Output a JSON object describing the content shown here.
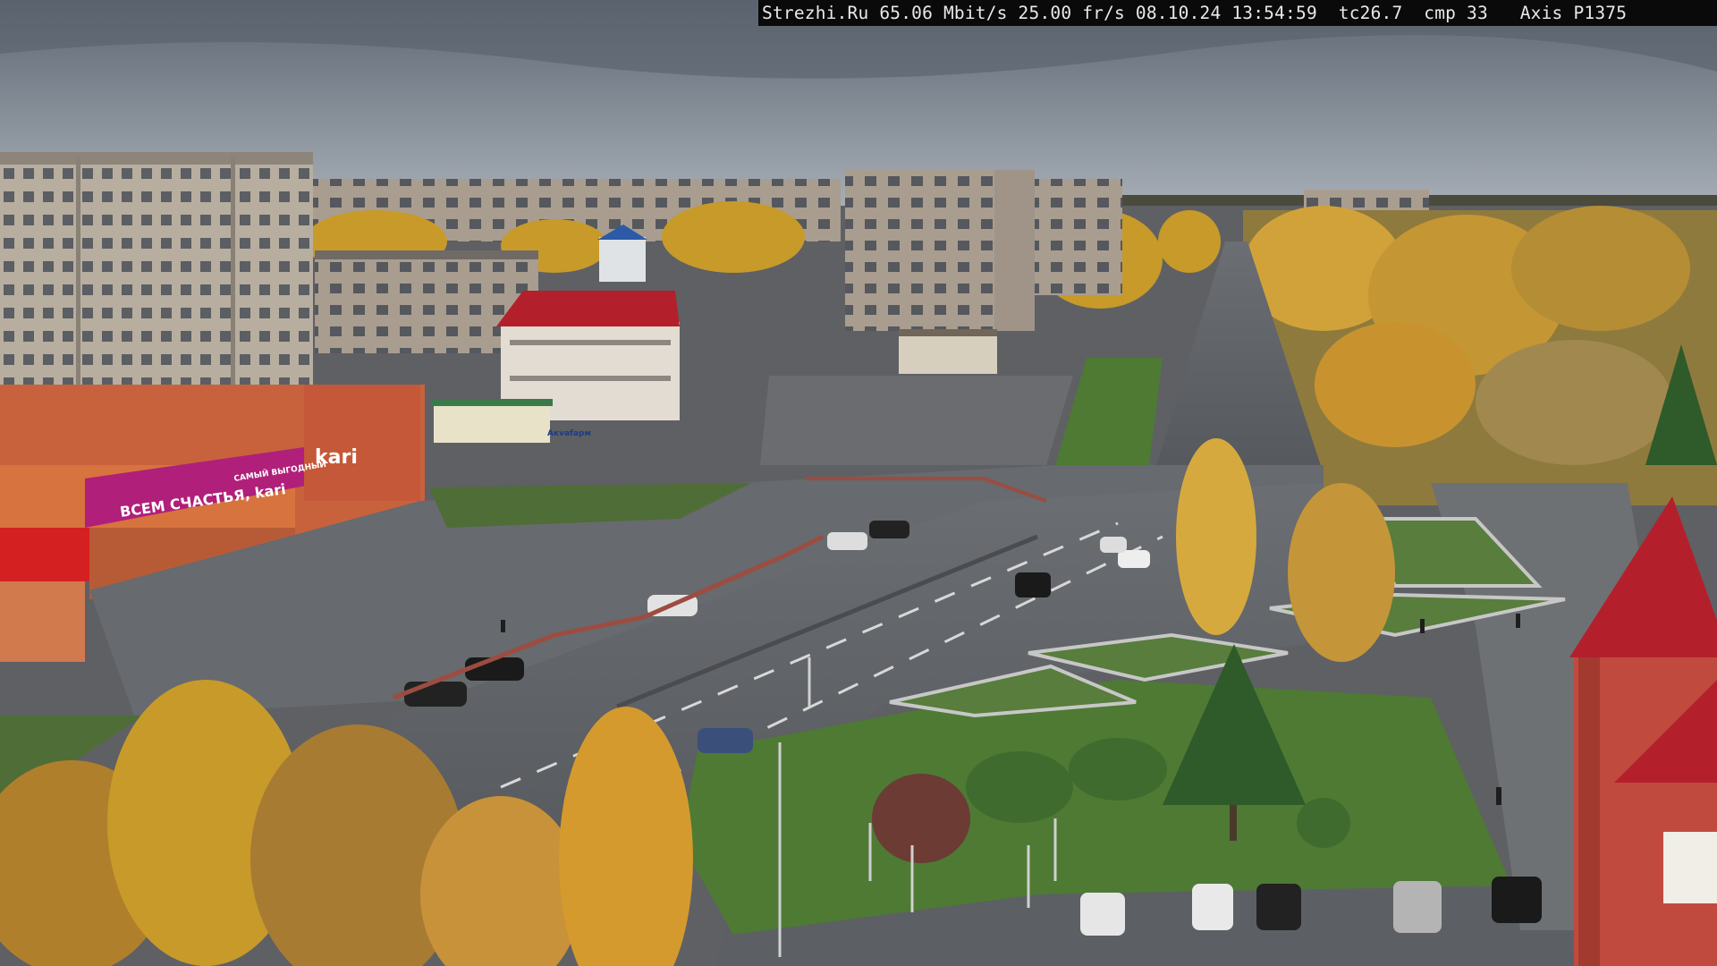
{
  "camera_overlay": {
    "text": "Strezhi.Ru 65.06 Mbit/s 25.00 fr/s 08.10.24 13:54:59  tc26.7  cmp 33   Axis P1375"
  },
  "signs": {
    "store_brand": "kari",
    "store_slogan": "ВСЕМ СЧАСТЬЯ, kari",
    "store_banner_small": "САМЫЙ ВЫГОДНЫЙ",
    "kiosk_label": "Aкvafарм"
  },
  "colors": {
    "sky_top": "#5f6873",
    "sky_bottom": "#a9b0b8",
    "asphalt": "#5c5f63",
    "grass": "#4e7a34",
    "autumn_foliage": "#c79a2a",
    "store_magenta": "#b01f7a",
    "store_facade": "#c8623c",
    "red_roof": "#b3202c"
  },
  "scene_objects": {
    "description_icons": [
      "apartment-blocks",
      "kari-store",
      "plaza",
      "boulevard",
      "trees",
      "parked-cars",
      "red-tower-building"
    ]
  }
}
